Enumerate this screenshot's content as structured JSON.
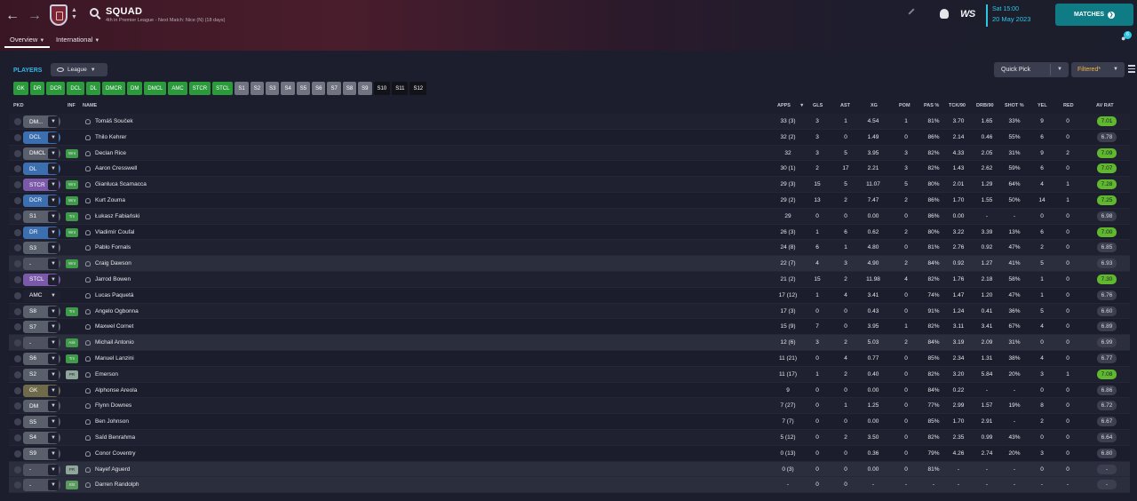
{
  "header": {
    "title": "SQUAD",
    "subtitle": "4th in Premier League - Next Match: Nice (N) (18 days)",
    "tabs": [
      {
        "label": "Overview",
        "active": true
      },
      {
        "label": "International",
        "active": false
      }
    ],
    "logo_text": "WS",
    "date_time": "Sat 15:00",
    "date_day": "20 May 2023",
    "matches_label": "MATCHES",
    "notification_count": "6",
    "colors": {
      "accent": "#2dc6e5",
      "matches_btn": "#0f7b84"
    }
  },
  "toolbar": {
    "players_label": "PLAYERS",
    "league_label": "League",
    "quick_pick_label": "Quick Pick",
    "filtered_label": "Filtered*"
  },
  "position_chips": [
    {
      "label": "GK",
      "style": "green"
    },
    {
      "label": "DR",
      "style": "green"
    },
    {
      "label": "DCR",
      "style": "green"
    },
    {
      "label": "DCL",
      "style": "green"
    },
    {
      "label": "DL",
      "style": "green"
    },
    {
      "label": "DMCR",
      "style": "green"
    },
    {
      "label": "DM",
      "style": "green"
    },
    {
      "label": "DMCL",
      "style": "green"
    },
    {
      "label": "AMC",
      "style": "green"
    },
    {
      "label": "STCR",
      "style": "green"
    },
    {
      "label": "STCL",
      "style": "green"
    },
    {
      "label": "S1",
      "style": "grey"
    },
    {
      "label": "S2",
      "style": "grey"
    },
    {
      "label": "S3",
      "style": "grey"
    },
    {
      "label": "S4",
      "style": "grey"
    },
    {
      "label": "S5",
      "style": "grey"
    },
    {
      "label": "S6",
      "style": "grey"
    },
    {
      "label": "S7",
      "style": "grey"
    },
    {
      "label": "S8",
      "style": "grey"
    },
    {
      "label": "S9",
      "style": "grey"
    },
    {
      "label": "S10",
      "style": "dark"
    },
    {
      "label": "S11",
      "style": "dark"
    },
    {
      "label": "S12",
      "style": "dark"
    }
  ],
  "table": {
    "headers": {
      "pkd": "PKD",
      "inf": "INF",
      "name": "NAME",
      "apps": "APPS",
      "gls": "GLS",
      "ast": "AST",
      "xg": "XG",
      "pom": "POM",
      "pas": "PAS %",
      "tck": "TCK/90",
      "drb": "DRB/90",
      "shot": "SHOT %",
      "yel": "YEL",
      "red": "RED",
      "av_rat": "AV RAT"
    },
    "rows": [
      {
        "pos": "DM...",
        "pos_color": "#5a5f6c",
        "inf": "",
        "name": "Tomáš Souček",
        "apps": "33 (3)",
        "gls": "3",
        "ast": "1",
        "xg": "4.54",
        "pom": "1",
        "pas": "81%",
        "tck": "3.70",
        "drb": "1.65",
        "shot": "33%",
        "yel": "9",
        "red": "0",
        "rat": "7.01",
        "rat_good": true,
        "hl": false
      },
      {
        "pos": "DCL",
        "pos_color": "#3c6fb0",
        "inf": "",
        "name": "Thilo Kehrer",
        "apps": "32 (2)",
        "gls": "3",
        "ast": "0",
        "xg": "1.49",
        "pom": "0",
        "pas": "86%",
        "tck": "2.14",
        "drb": "0.46",
        "shot": "55%",
        "yel": "6",
        "red": "0",
        "rat": "6.78",
        "rat_good": false,
        "hl": false
      },
      {
        "pos": "DMCL",
        "pos_color": "#5a5f6c",
        "inf": "Wnt",
        "name": "Declan Rice",
        "apps": "32",
        "gls": "3",
        "ast": "5",
        "xg": "3.95",
        "pom": "3",
        "pas": "82%",
        "tck": "4.33",
        "drb": "2.05",
        "shot": "31%",
        "yel": "9",
        "red": "2",
        "rat": "7.09",
        "rat_good": true,
        "hl": false
      },
      {
        "pos": "DL",
        "pos_color": "#3c6fb0",
        "inf": "",
        "name": "Aaron Cresswell",
        "apps": "30 (1)",
        "gls": "2",
        "ast": "17",
        "xg": "2.21",
        "pom": "3",
        "pas": "82%",
        "tck": "1.43",
        "drb": "2.62",
        "shot": "59%",
        "yel": "6",
        "red": "0",
        "rat": "7.07",
        "rat_good": true,
        "hl": false
      },
      {
        "pos": "STCR",
        "pos_color": "#7a5aa8",
        "inf": "Wnt",
        "name": "Gianluca Scamacca",
        "apps": "29 (3)",
        "gls": "15",
        "ast": "5",
        "xg": "11.07",
        "pom": "5",
        "pas": "80%",
        "tck": "2.01",
        "drb": "1.29",
        "shot": "64%",
        "yel": "4",
        "red": "1",
        "rat": "7.28",
        "rat_good": true,
        "hl": false
      },
      {
        "pos": "DCR",
        "pos_color": "#3c6fb0",
        "inf": "Wnt",
        "name": "Kurt Zouma",
        "apps": "29 (2)",
        "gls": "13",
        "ast": "2",
        "xg": "7.47",
        "pom": "2",
        "pas": "86%",
        "tck": "1.70",
        "drb": "1.55",
        "shot": "50%",
        "yel": "14",
        "red": "1",
        "rat": "7.25",
        "rat_good": true,
        "hl": false
      },
      {
        "pos": "S1",
        "pos_color": "#5a5f6c",
        "inf": "Trn",
        "name": "Łukasz Fabiański",
        "apps": "29",
        "gls": "0",
        "ast": "0",
        "xg": "0.00",
        "pom": "0",
        "pas": "86%",
        "tck": "0.00",
        "drb": "-",
        "shot": "-",
        "yel": "0",
        "red": "0",
        "rat": "6.98",
        "rat_good": false,
        "hl": false
      },
      {
        "pos": "DR",
        "pos_color": "#3c6fb0",
        "inf": "Wnt",
        "name": "Vladimír Coufal",
        "apps": "26 (3)",
        "gls": "1",
        "ast": "6",
        "xg": "0.62",
        "pom": "2",
        "pas": "80%",
        "tck": "3.22",
        "drb": "3.39",
        "shot": "13%",
        "yel": "6",
        "red": "0",
        "rat": "7.00",
        "rat_good": true,
        "hl": false
      },
      {
        "pos": "S3",
        "pos_color": "#5a5f6c",
        "inf": "",
        "name": "Pablo Fornals",
        "apps": "24 (8)",
        "gls": "6",
        "ast": "1",
        "xg": "4.80",
        "pom": "0",
        "pas": "81%",
        "tck": "2.76",
        "drb": "0.92",
        "shot": "47%",
        "yel": "2",
        "red": "0",
        "rat": "6.85",
        "rat_good": false,
        "hl": false
      },
      {
        "pos": "-",
        "pos_color": "#4d5160",
        "inf": "Wnt",
        "name": "Craig Dawson",
        "apps": "22 (7)",
        "gls": "4",
        "ast": "3",
        "xg": "4.90",
        "pom": "2",
        "pas": "84%",
        "tck": "0.92",
        "drb": "1.27",
        "shot": "41%",
        "yel": "5",
        "red": "0",
        "rat": "6.93",
        "rat_good": false,
        "hl": true
      },
      {
        "pos": "STCL",
        "pos_color": "#7a5aa8",
        "inf": "",
        "name": "Jarrod Bowen",
        "apps": "21 (2)",
        "gls": "15",
        "ast": "2",
        "xg": "11.98",
        "pom": "4",
        "pas": "82%",
        "tck": "1.76",
        "drb": "2.18",
        "shot": "58%",
        "yel": "1",
        "red": "0",
        "rat": "7.30",
        "rat_good": true,
        "hl": false
      },
      {
        "pos": "AMC",
        "pos_color": "#1f2131",
        "inf": "",
        "name": "Lucas Paquetá",
        "apps": "17 (12)",
        "gls": "1",
        "ast": "4",
        "xg": "3.41",
        "pom": "0",
        "pas": "74%",
        "tck": "1.47",
        "drb": "1.20",
        "shot": "47%",
        "yel": "1",
        "red": "0",
        "rat": "6.76",
        "rat_good": false,
        "hl": false
      },
      {
        "pos": "S8",
        "pos_color": "#5a5f6c",
        "inf": "Trn",
        "name": "Angelo Ogbonna",
        "apps": "17 (3)",
        "gls": "0",
        "ast": "0",
        "xg": "0.43",
        "pom": "0",
        "pas": "91%",
        "tck": "1.24",
        "drb": "0.41",
        "shot": "36%",
        "yel": "5",
        "red": "0",
        "rat": "6.60",
        "rat_good": false,
        "hl": false
      },
      {
        "pos": "S7",
        "pos_color": "#5a5f6c",
        "inf": "",
        "name": "Maxwel Cornet",
        "apps": "15 (9)",
        "gls": "7",
        "ast": "0",
        "xg": "3.95",
        "pom": "1",
        "pas": "82%",
        "tck": "3.11",
        "drb": "3.41",
        "shot": "67%",
        "yel": "4",
        "red": "0",
        "rat": "6.89",
        "rat_good": false,
        "hl": false
      },
      {
        "pos": "-",
        "pos_color": "#4d5160",
        "inf": "Ask",
        "name": "Michail Antonio",
        "apps": "12 (6)",
        "gls": "3",
        "ast": "2",
        "xg": "5.03",
        "pom": "2",
        "pas": "84%",
        "tck": "3.19",
        "drb": "2.09",
        "shot": "31%",
        "yel": "0",
        "red": "0",
        "rat": "6.99",
        "rat_good": false,
        "hl": true
      },
      {
        "pos": "S6",
        "pos_color": "#5a5f6c",
        "inf": "Trn",
        "name": "Manuel Lanzini",
        "apps": "11 (21)",
        "gls": "0",
        "ast": "4",
        "xg": "0.77",
        "pom": "0",
        "pas": "85%",
        "tck": "2.34",
        "drb": "1.31",
        "shot": "38%",
        "yel": "4",
        "red": "0",
        "rat": "6.77",
        "rat_good": false,
        "hl": false
      },
      {
        "pos": "S2",
        "pos_color": "#5a5f6c",
        "inf": "PR",
        "name": "Emerson",
        "apps": "11 (17)",
        "gls": "1",
        "ast": "2",
        "xg": "0.40",
        "pom": "0",
        "pas": "82%",
        "tck": "3.20",
        "drb": "5.84",
        "shot": "20%",
        "yel": "3",
        "red": "1",
        "rat": "7.08",
        "rat_good": true,
        "hl": false
      },
      {
        "pos": "GK",
        "pos_color": "#6e6a4a",
        "inf": "",
        "name": "Alphonse Areola",
        "apps": "9",
        "gls": "0",
        "ast": "0",
        "xg": "0.00",
        "pom": "0",
        "pas": "84%",
        "tck": "0.22",
        "drb": "-",
        "shot": "-",
        "yel": "0",
        "red": "0",
        "rat": "6.86",
        "rat_good": false,
        "hl": false
      },
      {
        "pos": "DM",
        "pos_color": "#5a5f6c",
        "inf": "",
        "name": "Flynn Downes",
        "apps": "7 (27)",
        "gls": "0",
        "ast": "1",
        "xg": "1.25",
        "pom": "0",
        "pas": "77%",
        "tck": "2.99",
        "drb": "1.57",
        "shot": "19%",
        "yel": "8",
        "red": "0",
        "rat": "6.72",
        "rat_good": false,
        "hl": false
      },
      {
        "pos": "S5",
        "pos_color": "#5a5f6c",
        "inf": "",
        "name": "Ben Johnson",
        "apps": "7 (7)",
        "gls": "0",
        "ast": "0",
        "xg": "0.00",
        "pom": "0",
        "pas": "85%",
        "tck": "1.70",
        "drb": "2.91",
        "shot": "-",
        "yel": "2",
        "red": "0",
        "rat": "6.67",
        "rat_good": false,
        "hl": false
      },
      {
        "pos": "S4",
        "pos_color": "#5a5f6c",
        "inf": "",
        "name": "Saïd Benrahma",
        "apps": "5 (12)",
        "gls": "0",
        "ast": "2",
        "xg": "3.50",
        "pom": "0",
        "pas": "82%",
        "tck": "2.35",
        "drb": "0.99",
        "shot": "43%",
        "yel": "0",
        "red": "0",
        "rat": "6.64",
        "rat_good": false,
        "hl": false
      },
      {
        "pos": "S9",
        "pos_color": "#5a5f6c",
        "inf": "",
        "name": "Conor Coventry",
        "apps": "0 (13)",
        "gls": "0",
        "ast": "0",
        "xg": "0.36",
        "pom": "0",
        "pas": "79%",
        "tck": "4.26",
        "drb": "2.74",
        "shot": "20%",
        "yel": "3",
        "red": "0",
        "rat": "6.80",
        "rat_good": false,
        "hl": false
      },
      {
        "pos": "-",
        "pos_color": "#4d5160",
        "inf": "PR",
        "name": "Nayef Aguerd",
        "apps": "0 (3)",
        "gls": "0",
        "ast": "0",
        "xg": "0.00",
        "pom": "0",
        "pas": "81%",
        "tck": "-",
        "drb": "-",
        "shot": "-",
        "yel": "0",
        "red": "0",
        "rat": "-",
        "rat_good": false,
        "hl": true
      },
      {
        "pos": "-",
        "pos_color": "#4d5160",
        "inf": "Sht",
        "name": "Darren Randolph",
        "apps": "-",
        "gls": "0",
        "ast": "0",
        "xg": "-",
        "pom": "-",
        "pas": "-",
        "tck": "-",
        "drb": "-",
        "shot": "-",
        "yel": "-",
        "red": "-",
        "rat": "-",
        "rat_good": false,
        "hl": true
      }
    ]
  },
  "colors": {
    "rating_good": "#5fb82d",
    "players_label": "#34b6e6",
    "filtered": "#f0b44a"
  }
}
